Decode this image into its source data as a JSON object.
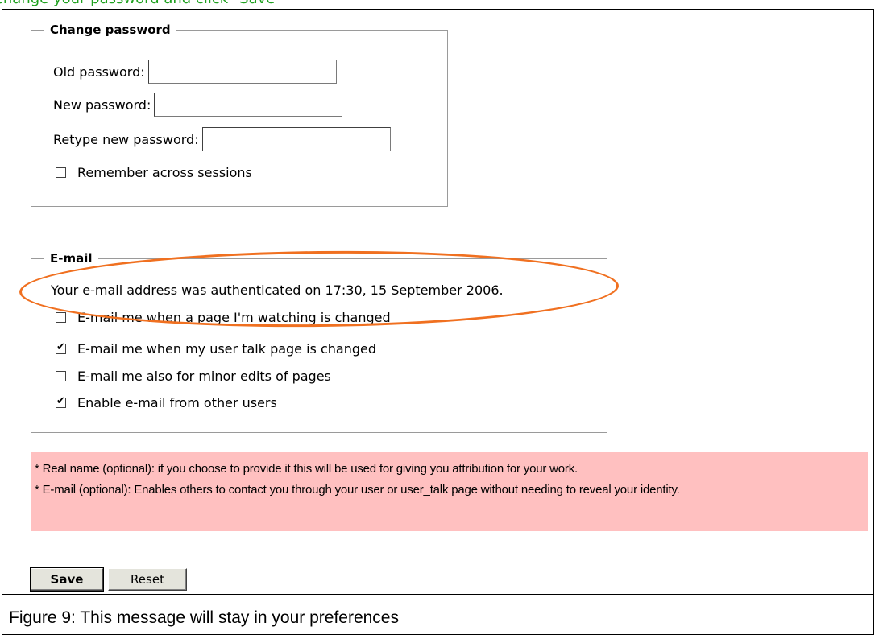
{
  "instruction_header": "change your password and click \"Save\"",
  "password_section": {
    "legend": "Change password",
    "old_password_label": "Old password:",
    "new_password_label": "New password:",
    "retype_password_label": "Retype new password:",
    "remember_label": "Remember across sessions",
    "remember_checked": false
  },
  "email_section": {
    "legend": "E-mail",
    "authenticated_message": "Your e-mail address was authenticated on 17:30, 15 September 2006.",
    "options": [
      {
        "label": "E-mail me when a page I'm watching is changed",
        "checked": false
      },
      {
        "label": "E-mail me when my user talk page is changed",
        "checked": true
      },
      {
        "label": "E-mail me also for minor edits of pages",
        "checked": false
      },
      {
        "label": "Enable e-mail from other users",
        "checked": true
      }
    ]
  },
  "notice": {
    "line1": "* Real name (optional): if you choose to provide it this will be used for giving you attribution for your work.",
    "line2": "* E-mail (optional): Enables others to contact you through your user or user_talk page without needing to reveal your identity."
  },
  "buttons": {
    "save_label": "Save",
    "reset_label": "Reset"
  },
  "caption": "Figure 9: This message will stay in your preferences",
  "colors": {
    "highlight_ellipse": "#f07020",
    "notice_background": "#ffc0c0",
    "header_text": "#1fa01f"
  }
}
